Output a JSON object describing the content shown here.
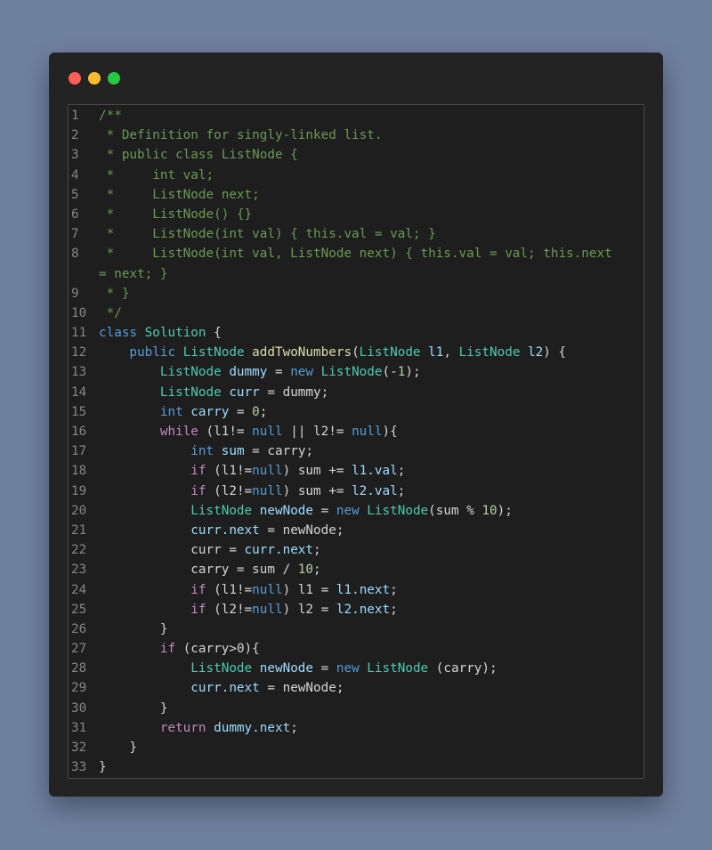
{
  "window": {
    "controls": [
      "close",
      "minimize",
      "maximize"
    ],
    "colors": {
      "close": "#ff5f57",
      "minimize": "#febc2e",
      "maximize": "#28c840"
    }
  },
  "code": {
    "lines": [
      {
        "n": "1",
        "tokens": [
          [
            "/**",
            "cm"
          ]
        ]
      },
      {
        "n": "2",
        "tokens": [
          [
            " * Definition for singly-linked list.",
            "cm"
          ]
        ]
      },
      {
        "n": "3",
        "tokens": [
          [
            " * public class ListNode {",
            "cm"
          ]
        ]
      },
      {
        "n": "4",
        "tokens": [
          [
            " *     int val;",
            "cm"
          ]
        ]
      },
      {
        "n": "5",
        "tokens": [
          [
            " *     ListNode next;",
            "cm"
          ]
        ]
      },
      {
        "n": "6",
        "tokens": [
          [
            " *     ListNode() {}",
            "cm"
          ]
        ]
      },
      {
        "n": "7",
        "tokens": [
          [
            " *     ListNode(int val) { this.val = val; }",
            "cm"
          ]
        ]
      },
      {
        "n": "8",
        "tokens": [
          [
            " *     ListNode(int val, ListNode next) { this.val = val; this.next",
            "cm"
          ]
        ]
      },
      {
        "n": "",
        "tokens": [
          [
            "= next; }",
            "cm"
          ]
        ]
      },
      {
        "n": "9",
        "tokens": [
          [
            " * }",
            "cm"
          ]
        ]
      },
      {
        "n": "10",
        "tokens": [
          [
            " */",
            "cm"
          ]
        ]
      },
      {
        "n": "11",
        "tokens": [
          [
            "class ",
            "kb"
          ],
          [
            "Solution",
            "ty"
          ],
          [
            " {",
            "tx"
          ]
        ]
      },
      {
        "n": "12",
        "tokens": [
          [
            "    public ",
            "kb"
          ],
          [
            "ListNode ",
            "ty"
          ],
          [
            "addTwoNumbers",
            "fn"
          ],
          [
            "(",
            "tx"
          ],
          [
            "ListNode ",
            "ty"
          ],
          [
            "l1",
            "id"
          ],
          [
            ", ",
            "tx"
          ],
          [
            "ListNode ",
            "ty"
          ],
          [
            "l2",
            "id"
          ],
          [
            ") {",
            "tx"
          ]
        ]
      },
      {
        "n": "13",
        "tokens": [
          [
            "        ListNode ",
            "ty"
          ],
          [
            "dummy",
            "id"
          ],
          [
            " = ",
            "tx"
          ],
          [
            "new ",
            "kb"
          ],
          [
            "ListNode",
            "ty"
          ],
          [
            "(-",
            "tx"
          ],
          [
            "1",
            "nm"
          ],
          [
            ");",
            "tx"
          ]
        ]
      },
      {
        "n": "14",
        "tokens": [
          [
            "        ListNode ",
            "ty"
          ],
          [
            "curr",
            "id"
          ],
          [
            " = dummy;",
            "tx"
          ]
        ]
      },
      {
        "n": "15",
        "tokens": [
          [
            "        int ",
            "kb"
          ],
          [
            "carry",
            "id"
          ],
          [
            " = ",
            "tx"
          ],
          [
            "0",
            "nm"
          ],
          [
            ";",
            "tx"
          ]
        ]
      },
      {
        "n": "16",
        "tokens": [
          [
            "        while ",
            "kw"
          ],
          [
            "(l1!= ",
            "tx"
          ],
          [
            "null",
            "kb"
          ],
          [
            " || l2!= ",
            "tx"
          ],
          [
            "null",
            "kb"
          ],
          [
            "){",
            "tx"
          ]
        ]
      },
      {
        "n": "17",
        "tokens": [
          [
            "            int ",
            "kb"
          ],
          [
            "sum",
            "id"
          ],
          [
            " = carry;",
            "tx"
          ]
        ]
      },
      {
        "n": "18",
        "tokens": [
          [
            "            if ",
            "kw"
          ],
          [
            "(l1!=",
            "tx"
          ],
          [
            "null",
            "kb"
          ],
          [
            ") sum += ",
            "tx"
          ],
          [
            "l1.val",
            "id"
          ],
          [
            ";",
            "tx"
          ]
        ]
      },
      {
        "n": "19",
        "tokens": [
          [
            "            if ",
            "kw"
          ],
          [
            "(l2!=",
            "tx"
          ],
          [
            "null",
            "kb"
          ],
          [
            ") sum += ",
            "tx"
          ],
          [
            "l2.val",
            "id"
          ],
          [
            ";",
            "tx"
          ]
        ]
      },
      {
        "n": "20",
        "tokens": [
          [
            "            ListNode ",
            "ty"
          ],
          [
            "newNode",
            "id"
          ],
          [
            " = ",
            "tx"
          ],
          [
            "new ",
            "kb"
          ],
          [
            "ListNode",
            "ty"
          ],
          [
            "(sum % ",
            "tx"
          ],
          [
            "10",
            "nm"
          ],
          [
            ");",
            "tx"
          ]
        ]
      },
      {
        "n": "21",
        "tokens": [
          [
            "            curr.next",
            "id"
          ],
          [
            " = newNode;",
            "tx"
          ]
        ]
      },
      {
        "n": "22",
        "tokens": [
          [
            "            curr = ",
            "tx"
          ],
          [
            "curr.next",
            "id"
          ],
          [
            ";",
            "tx"
          ]
        ]
      },
      {
        "n": "23",
        "tokens": [
          [
            "            carry = sum / ",
            "tx"
          ],
          [
            "10",
            "nm"
          ],
          [
            ";",
            "tx"
          ]
        ]
      },
      {
        "n": "24",
        "tokens": [
          [
            "            if ",
            "kw"
          ],
          [
            "(l1!=",
            "tx"
          ],
          [
            "null",
            "kb"
          ],
          [
            ") l1 = ",
            "tx"
          ],
          [
            "l1.next",
            "id"
          ],
          [
            ";",
            "tx"
          ]
        ]
      },
      {
        "n": "25",
        "tokens": [
          [
            "            if ",
            "kw"
          ],
          [
            "(l2!=",
            "tx"
          ],
          [
            "null",
            "kb"
          ],
          [
            ") l2 = ",
            "tx"
          ],
          [
            "l2.next",
            "id"
          ],
          [
            ";",
            "tx"
          ]
        ]
      },
      {
        "n": "26",
        "tokens": [
          [
            "        }",
            "tx"
          ]
        ]
      },
      {
        "n": "27",
        "tokens": [
          [
            "        if ",
            "kw"
          ],
          [
            "(carry>0){",
            "tx"
          ]
        ]
      },
      {
        "n": "28",
        "tokens": [
          [
            "            ListNode ",
            "ty"
          ],
          [
            "newNode",
            "id"
          ],
          [
            " = ",
            "tx"
          ],
          [
            "new ",
            "kb"
          ],
          [
            "ListNode ",
            "ty"
          ],
          [
            "(carry);",
            "tx"
          ]
        ]
      },
      {
        "n": "29",
        "tokens": [
          [
            "            curr.next",
            "id"
          ],
          [
            " = newNode;",
            "tx"
          ]
        ]
      },
      {
        "n": "30",
        "tokens": [
          [
            "        }",
            "tx"
          ]
        ]
      },
      {
        "n": "31",
        "tokens": [
          [
            "        return ",
            "kw"
          ],
          [
            "dummy.next",
            "id"
          ],
          [
            ";",
            "tx"
          ]
        ]
      },
      {
        "n": "32",
        "tokens": [
          [
            "    }",
            "tx"
          ]
        ]
      },
      {
        "n": "33",
        "tokens": [
          [
            "}",
            "tx"
          ]
        ]
      }
    ]
  }
}
